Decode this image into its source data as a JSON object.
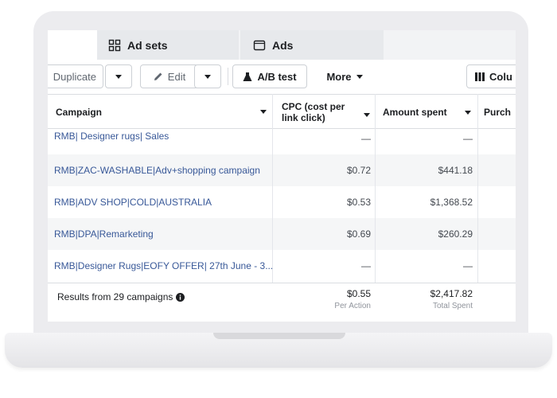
{
  "tabs": {
    "ad_sets": "Ad sets",
    "ads": "Ads"
  },
  "toolbar": {
    "duplicate": "Duplicate",
    "edit": "Edit",
    "ab_test": "A/B test",
    "more": "More",
    "columns": "Colu"
  },
  "table": {
    "headers": {
      "campaign": "Campaign",
      "cpc_line1": "CPC (cost per",
      "cpc_line2": "link click)",
      "amount_spent": "Amount spent",
      "purchases": "Purch"
    },
    "rows": [
      {
        "name": "RMB| Designer rugs| Sales",
        "cpc": "—",
        "amount": "—"
      },
      {
        "name": "RMB|ZAC-WASHABLE|Adv+shopping campaign",
        "cpc": "$0.72",
        "amount": "$441.18"
      },
      {
        "name": "RMB|ADV SHOP|COLD|AUSTRALIA",
        "cpc": "$0.53",
        "amount": "$1,368.52"
      },
      {
        "name": "RMB|DPA|Remarketing",
        "cpc": "$0.69",
        "amount": "$260.29"
      },
      {
        "name": "RMB|Designer Rugs|EOFY OFFER| 27th June - 3...",
        "cpc": "—",
        "amount": "—"
      }
    ],
    "footer": {
      "results": "Results from 29 campaigns",
      "cpc": "$0.55",
      "cpc_sub": "Per Action",
      "amount": "$2,417.82",
      "amount_sub": "Total Spent"
    }
  },
  "colors": {
    "link": "#385898",
    "alt_row": "#f5f6f7",
    "tab_bg": "#e7e9ec"
  }
}
